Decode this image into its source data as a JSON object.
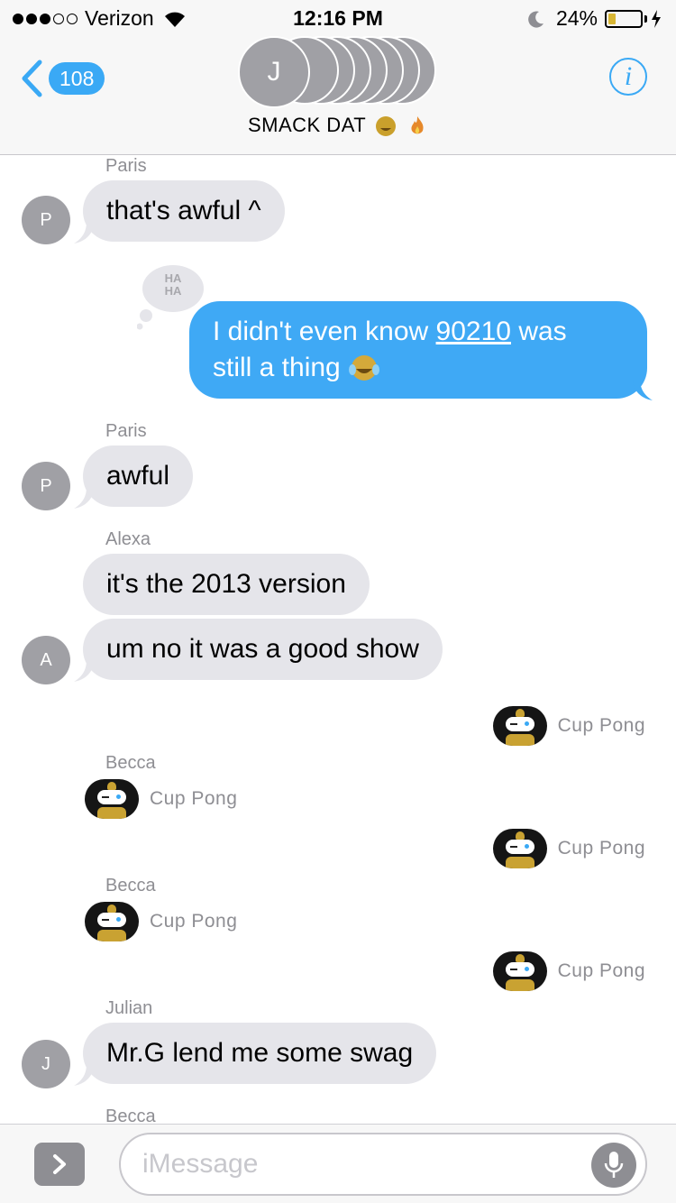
{
  "status_bar": {
    "carrier": "Verizon",
    "time": "12:16 PM",
    "battery_percent": "24%",
    "battery_level": 0.24,
    "signal_bars_filled": 3,
    "signal_bars_total": 5
  },
  "nav": {
    "back_count": "108",
    "group_initial": "J",
    "group_name": "SMACK DAT",
    "info_glyph": "i",
    "accent_color": "#3aa9f5"
  },
  "messages": {
    "m1": {
      "sender": "Paris",
      "avatar": "P",
      "text": "that's awful ^"
    },
    "m2": {
      "tapback": "HA HA",
      "text_before": "I didn't even know ",
      "link": "90210",
      "text_after": " was",
      "line2": "still a thing"
    },
    "m3": {
      "sender": "Paris",
      "avatar": "P",
      "text": "awful"
    },
    "m4": {
      "sender": "Alexa",
      "avatar": "A",
      "text1": "it's the 2013 version",
      "text2": "um no it was a good show"
    },
    "g1": {
      "label": "Cup Pong"
    },
    "g2": {
      "sender": "Becca",
      "label": "Cup Pong"
    },
    "g3": {
      "label": "Cup Pong"
    },
    "g4": {
      "sender": "Becca",
      "label": "Cup Pong"
    },
    "g5": {
      "label": "Cup Pong"
    },
    "m5": {
      "sender": "Julian",
      "avatar": "J",
      "text": "Mr.G lend me some swag"
    },
    "m6": {
      "sender": "Becca"
    }
  },
  "input": {
    "placeholder": "iMessage"
  },
  "icons": {
    "back": "chevron-left-icon",
    "info": "info-icon",
    "mic": "microphone-icon",
    "expand": "chevron-right-icon",
    "game": "cup-pong-icon"
  }
}
